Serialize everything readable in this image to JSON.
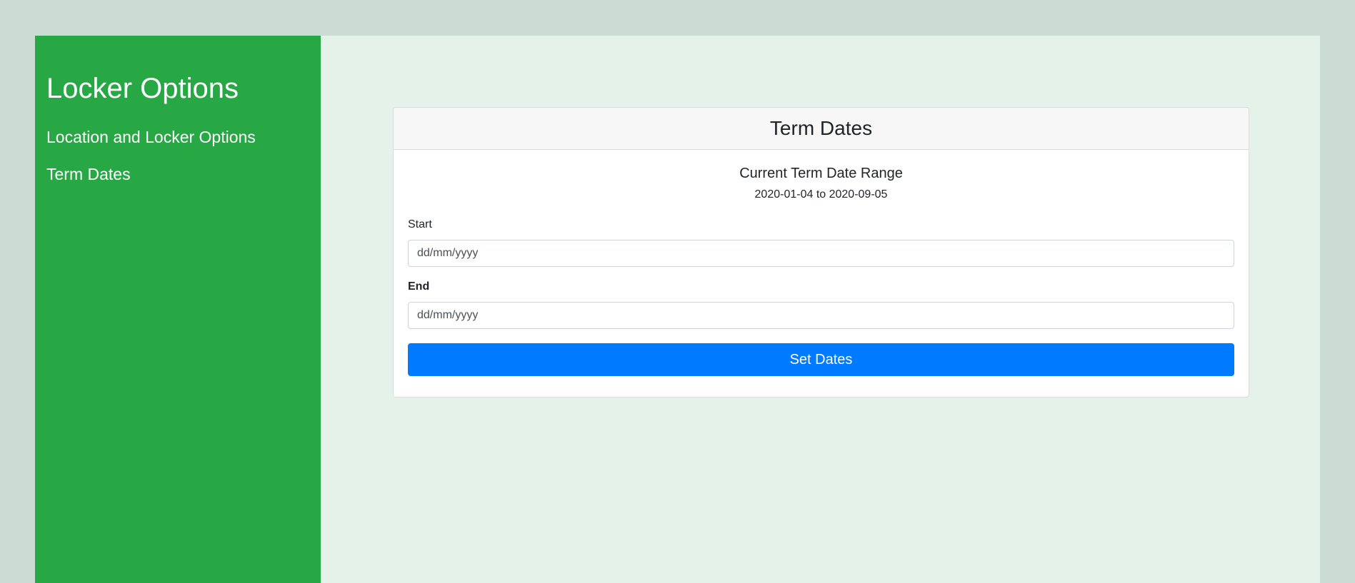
{
  "sidebar": {
    "title": "Locker Options",
    "items": [
      {
        "label": "Location and Locker Options"
      },
      {
        "label": "Term Dates"
      }
    ]
  },
  "card": {
    "header": "Term Dates",
    "range_title": "Current Term Date Range",
    "range_value": "2020-01-04 to 2020-09-05",
    "start_label": "Start",
    "start_placeholder": "dd/mm/yyyy",
    "end_label": "End",
    "end_placeholder": "dd/mm/yyyy",
    "button_label": "Set Dates"
  },
  "colors": {
    "page_background": "#cadcd3",
    "sidebar_background": "#28a745",
    "main_background": "#e4f2e9",
    "button_primary": "#007bff"
  }
}
